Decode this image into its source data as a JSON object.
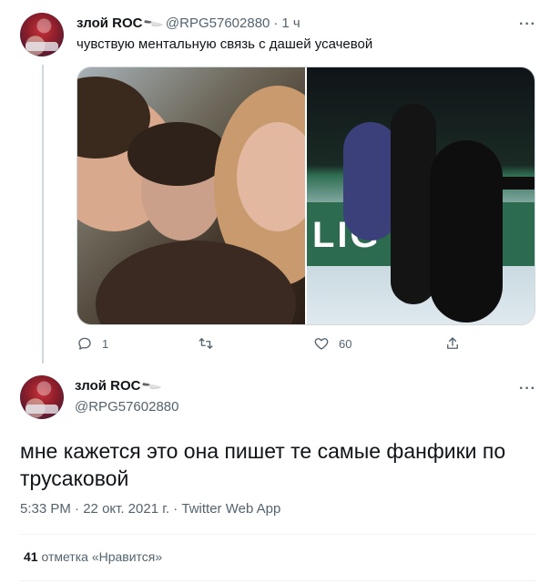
{
  "tweet1": {
    "name": "злой ROC",
    "handle": "@RPG57602880",
    "separator": "·",
    "time": "1 ч",
    "text": "чувствую ментальную связь с дашей усачевой",
    "actions": {
      "reply_count": "1",
      "retweet_count": "",
      "like_count": "60",
      "share_count": ""
    }
  },
  "tweet2": {
    "name": "злой ROC",
    "handle": "@RPG57602880",
    "text": "мне кажется это она пишет те самые фанфики по трусаковой",
    "time": "5:33 PM",
    "date": "22 окт. 2021 г.",
    "source": "Twitter Web App",
    "dot": "·",
    "likes": {
      "count": "41",
      "label": "отметка «Нравится»"
    }
  },
  "media_text": {
    "right_banner": "LIG AVO"
  },
  "colors": {
    "text": "#0f1419",
    "muted": "#536471",
    "border": "#cfd9de",
    "divider": "#eff3f4"
  }
}
